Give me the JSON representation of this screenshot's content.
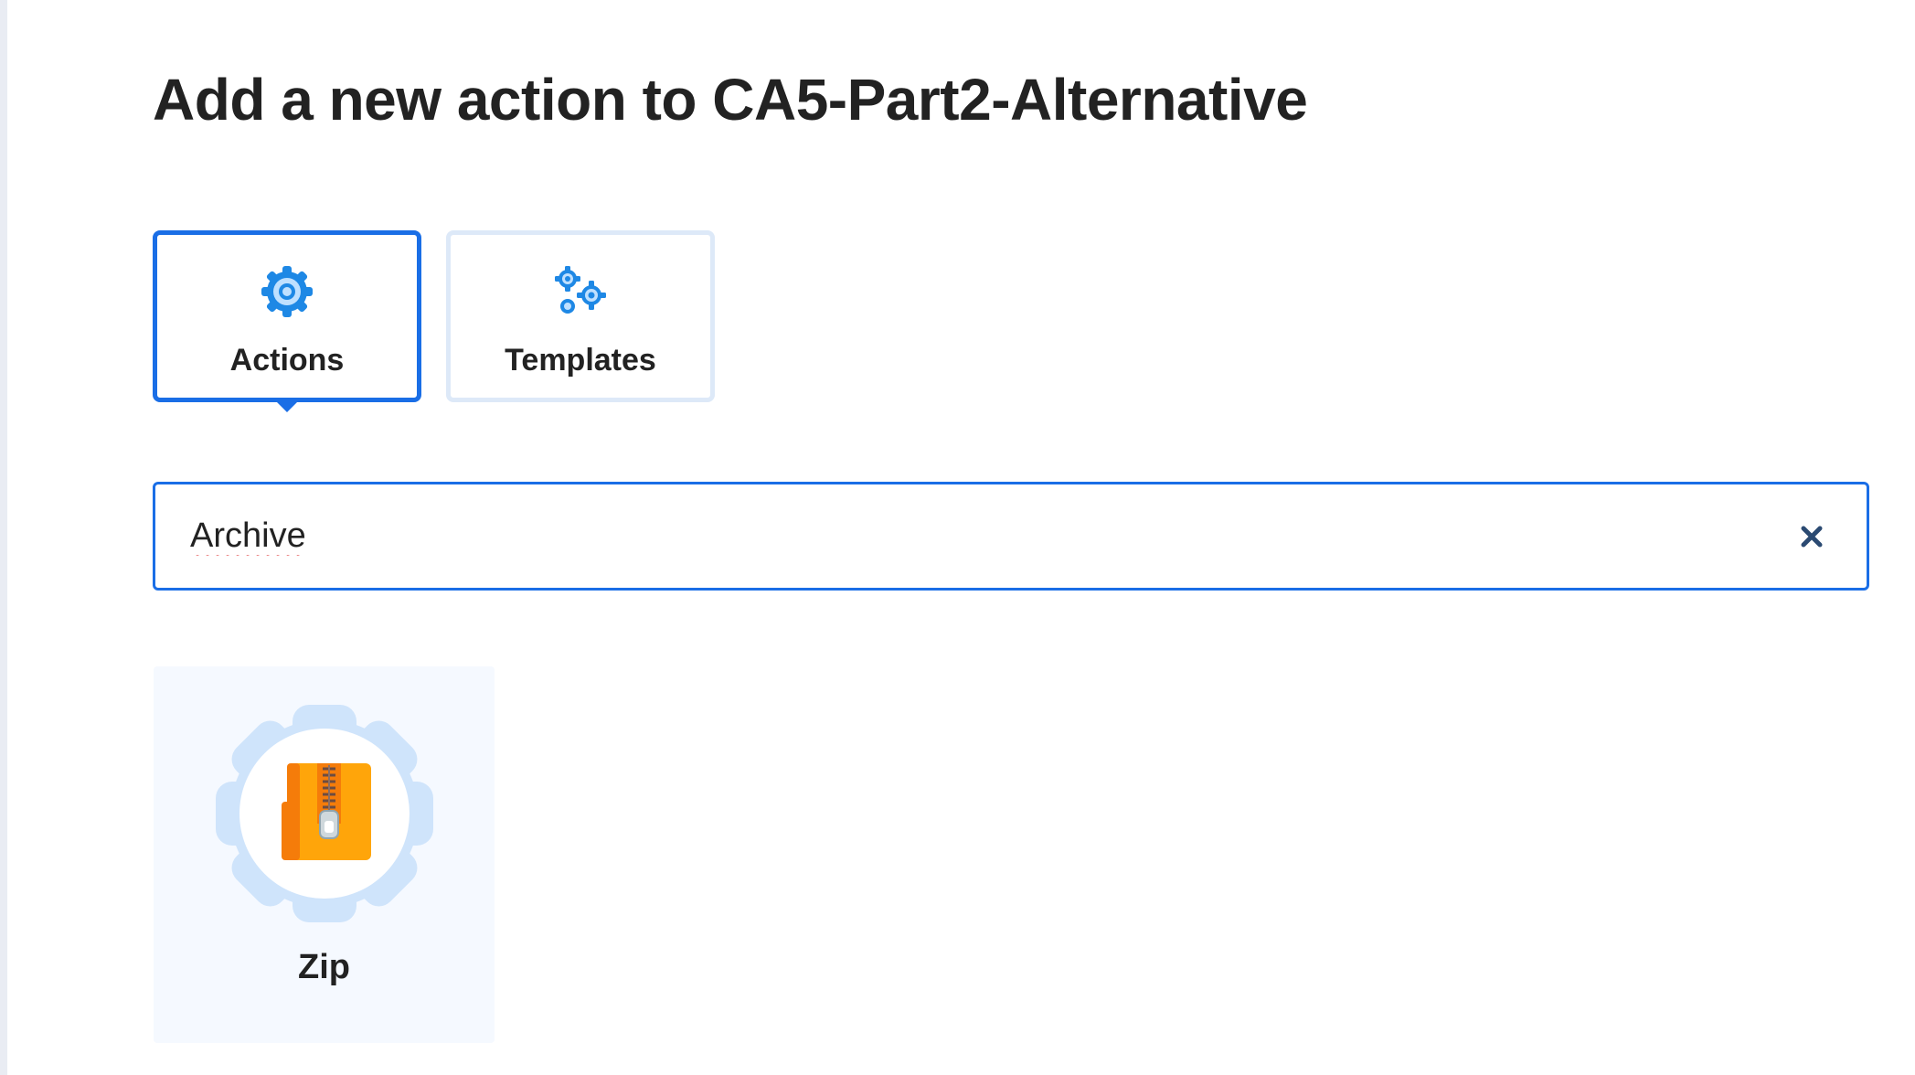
{
  "page": {
    "title": "Add a new action to CA5-Part2-Alternative"
  },
  "tabs": [
    {
      "label": "Actions",
      "icon": "gear-icon",
      "selected": true
    },
    {
      "label": "Templates",
      "icon": "gears-icon",
      "selected": false
    }
  ],
  "search": {
    "value": "Archive",
    "clear_icon": "close-icon"
  },
  "results": [
    {
      "label": "Zip",
      "icon": "zip-archive-icon"
    }
  ],
  "colors": {
    "accent": "#1a6ee6",
    "icon_blue": "#1e88e5",
    "zip_orange": "#ffa50a",
    "zip_dark_orange": "#f57c0a",
    "gear_badge": "#cfe4fb"
  }
}
